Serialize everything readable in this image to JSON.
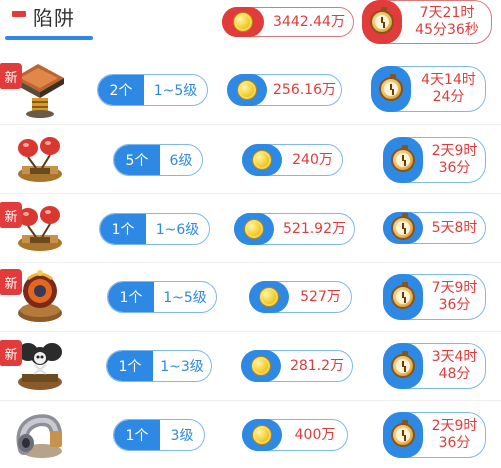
{
  "header": {
    "title": "陷阱",
    "total_cost": "3442.44万",
    "total_time_line1": "7天21时",
    "total_time_line2": "45分36秒"
  },
  "colors": {
    "accent_blue": "#2e89e4",
    "accent_red": "#e23b3b"
  },
  "new_badge_label": "新",
  "traps": [
    {
      "is_new": true,
      "count": "2个",
      "levels": "1~5级",
      "cost": "256.16万",
      "time_line1": "4天14时",
      "time_line2": "24分"
    },
    {
      "is_new": false,
      "count": "5个",
      "levels": "6级",
      "cost": "240万",
      "time_line1": "2天9时",
      "time_line2": "36分"
    },
    {
      "is_new": true,
      "count": "1个",
      "levels": "1~6级",
      "cost": "521.92万",
      "time_line1": "5天8时",
      "time_line2": ""
    },
    {
      "is_new": true,
      "count": "1个",
      "levels": "1~5级",
      "cost": "527万",
      "time_line1": "7天9时",
      "time_line2": "36分"
    },
    {
      "is_new": true,
      "count": "1个",
      "levels": "1~3级",
      "cost": "281.2万",
      "time_line1": "3天4时",
      "time_line2": "48分"
    },
    {
      "is_new": false,
      "count": "1个",
      "levels": "3级",
      "cost": "400万",
      "time_line1": "2天9时",
      "time_line2": "36分"
    }
  ]
}
